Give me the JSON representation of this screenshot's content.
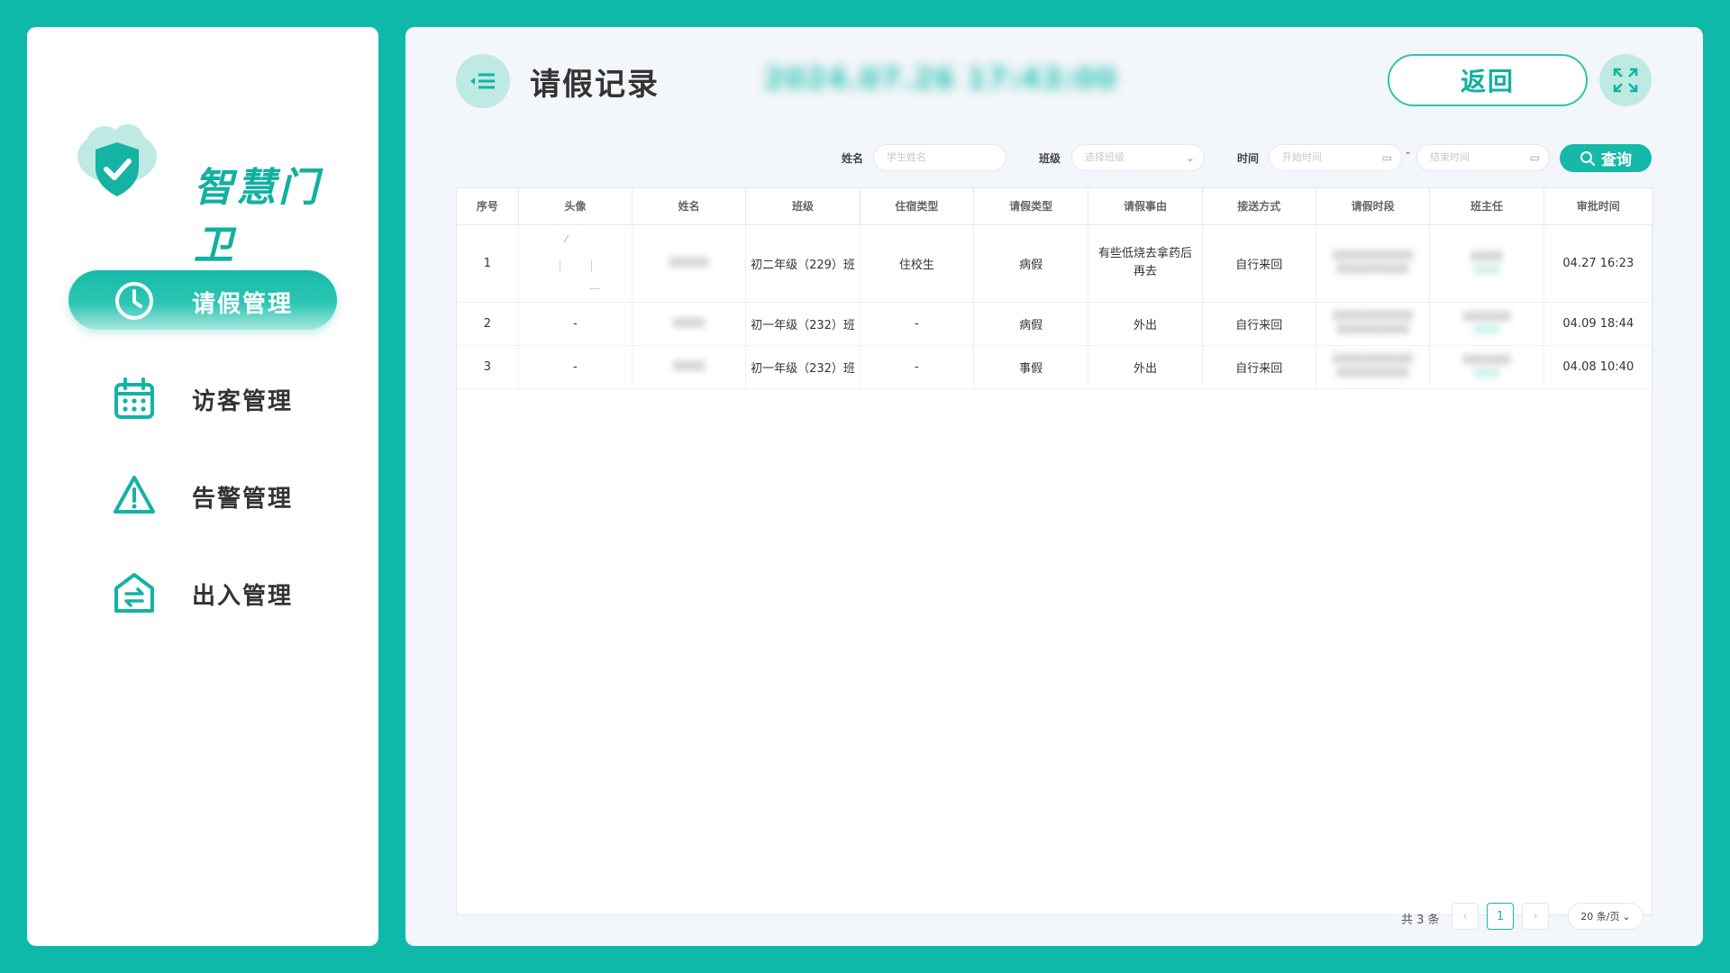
{
  "brand": {
    "name": "智慧门卫"
  },
  "sidebar": {
    "items": [
      {
        "label": "请假管理",
        "icon": "clock-icon",
        "active": true
      },
      {
        "label": "访客管理",
        "icon": "calendar-icon",
        "active": false
      },
      {
        "label": "告警管理",
        "icon": "warning-icon",
        "active": false
      },
      {
        "label": "出入管理",
        "icon": "home-exchange-icon",
        "active": false
      }
    ]
  },
  "header": {
    "title": "请假记录",
    "datetime": "2024.07.26 17:43:00",
    "back_label": "返回"
  },
  "filters": {
    "name_label": "姓名",
    "name_placeholder": "学生姓名",
    "class_label": "班级",
    "class_placeholder": "选择班级",
    "time_label": "时间",
    "start_placeholder": "开始时间",
    "end_placeholder": "结束时间",
    "separator": "-",
    "query_label": "查询"
  },
  "table": {
    "columns": [
      "序号",
      "头像",
      "姓名",
      "班级",
      "住宿类型",
      "请假类型",
      "请假事由",
      "接送方式",
      "请假时段",
      "班主任",
      "审批时间"
    ],
    "rows": [
      {
        "index": "1",
        "avatar": "",
        "name": "XXXXX",
        "class": "初二年级（229）班",
        "lodging": "住校生",
        "leave_type": "病假",
        "reason": "有些低烧去拿药后再去",
        "pickup": "自行来回",
        "period": "XXXXXXXXXX XXXXXXXXX",
        "teacher": "XXXX",
        "teacher_phone": "XXXX",
        "approved": "04.27 16:23"
      },
      {
        "index": "2",
        "avatar": "-",
        "name": "XXXX",
        "class": "初一年级（232）班",
        "lodging": "-",
        "leave_type": "病假",
        "reason": "外出",
        "pickup": "自行来回",
        "period": "XXXXXXXXXX XXXXXXXXX",
        "teacher": "XXXXXX",
        "teacher_phone": "XXXX",
        "approved": "04.09 18:44"
      },
      {
        "index": "3",
        "avatar": "-",
        "name": "XXXX",
        "class": "初一年级（232）班",
        "lodging": "-",
        "leave_type": "事假",
        "reason": "外出",
        "pickup": "自行来回",
        "period": "XXXXXXXXXX XXXXXXXXX",
        "teacher": "XXXXXX",
        "teacher_phone": "XXXX",
        "approved": "04.08 10:40"
      }
    ]
  },
  "pagination": {
    "total_text": "共 3 条",
    "prev": "‹",
    "current": "1",
    "next": "›",
    "page_size": "20 条/页"
  },
  "colors": {
    "accent": "#0fb9a9",
    "panel": "#f3f6fa"
  }
}
